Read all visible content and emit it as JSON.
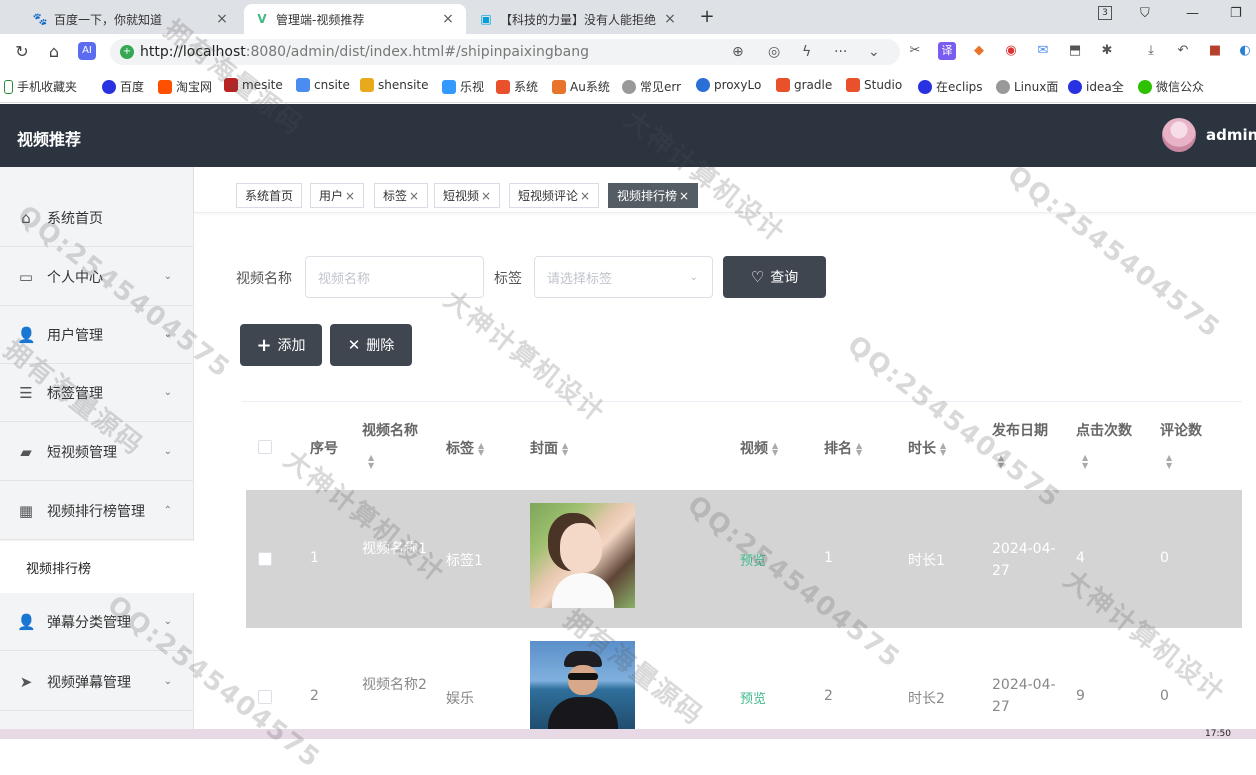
{
  "browser": {
    "tabs": [
      {
        "title": "百度一下，你就知道",
        "icon": "baidu-icon"
      },
      {
        "title": "管理端-视频推荐",
        "icon": "vue-icon"
      },
      {
        "title": "【科技的力量】没有人能拒绝",
        "icon": "bilibili-icon"
      }
    ],
    "new_tab": "+",
    "url_host": "http://localhost",
    "url_path": ":8080/admin/dist/index.html#/shipinpaixingbang",
    "tab_count": "3",
    "bookmarks": [
      "手机收藏夹",
      "百度",
      "淘宝网",
      "mesite",
      "cnsite",
      "shensite",
      "乐视",
      "系统",
      "Au系统",
      "常见err",
      "proxyLo",
      "gradle",
      "Studio",
      "在eclips",
      "Linux面",
      "idea全",
      "微信公众"
    ],
    "ext_translate": "译",
    "clock": "17:50"
  },
  "header": {
    "title": "视频推荐",
    "username": "admin"
  },
  "sidebar": {
    "items": [
      {
        "label": "系统首页",
        "icon": "home-icon",
        "chevron": ""
      },
      {
        "label": "个人中心",
        "icon": "card-icon",
        "chevron": "⌄"
      },
      {
        "label": "用户管理",
        "icon": "user-icon",
        "chevron": "⌄"
      },
      {
        "label": "标签管理",
        "icon": "sliders-icon",
        "chevron": "⌄"
      },
      {
        "label": "短视频管理",
        "icon": "briefcase-icon",
        "chevron": "⌄"
      },
      {
        "label": "视频排行榜管理",
        "icon": "grid-icon",
        "chevron": "⌃"
      },
      {
        "label": "弹幕分类管理",
        "icon": "user-icon",
        "chevron": "⌄"
      },
      {
        "label": "视频弹幕管理",
        "icon": "send-icon",
        "chevron": "⌄"
      }
    ],
    "subitem": "视频排行榜"
  },
  "tags": [
    {
      "label": "系统首页",
      "closable": false
    },
    {
      "label": "用户",
      "closable": true
    },
    {
      "label": "标签",
      "closable": true
    },
    {
      "label": "短视频",
      "closable": true
    },
    {
      "label": "短视频评论",
      "closable": true
    },
    {
      "label": "视频排行榜",
      "closable": true,
      "active": true
    }
  ],
  "search": {
    "name_label": "视频名称",
    "name_placeholder": "视频名称",
    "tag_label": "标签",
    "tag_placeholder": "请选择标签",
    "query_button": "查询"
  },
  "actions": {
    "add_button": "添加",
    "delete_button": "删除"
  },
  "table": {
    "columns": [
      "序号",
      "视频名称",
      "标签",
      "封面",
      "视频",
      "排名",
      "时长",
      "发布日期",
      "点击次数",
      "评论数"
    ],
    "rows": [
      {
        "index": "1",
        "name": "视频名称1",
        "tag": "标签1",
        "video": "预览",
        "rank": "1",
        "duration": "时长1",
        "date": "2024-04-27",
        "clicks": "4",
        "comments": "0"
      },
      {
        "index": "2",
        "name": "视频名称2",
        "tag": "娱乐",
        "video": "预览",
        "rank": "2",
        "duration": "时长2",
        "date": "2024-04-27",
        "clicks": "9",
        "comments": "0"
      }
    ]
  },
  "watermark": [
    "拥有海量源码",
    "QQ:2545404575",
    "大神计算机设计"
  ]
}
